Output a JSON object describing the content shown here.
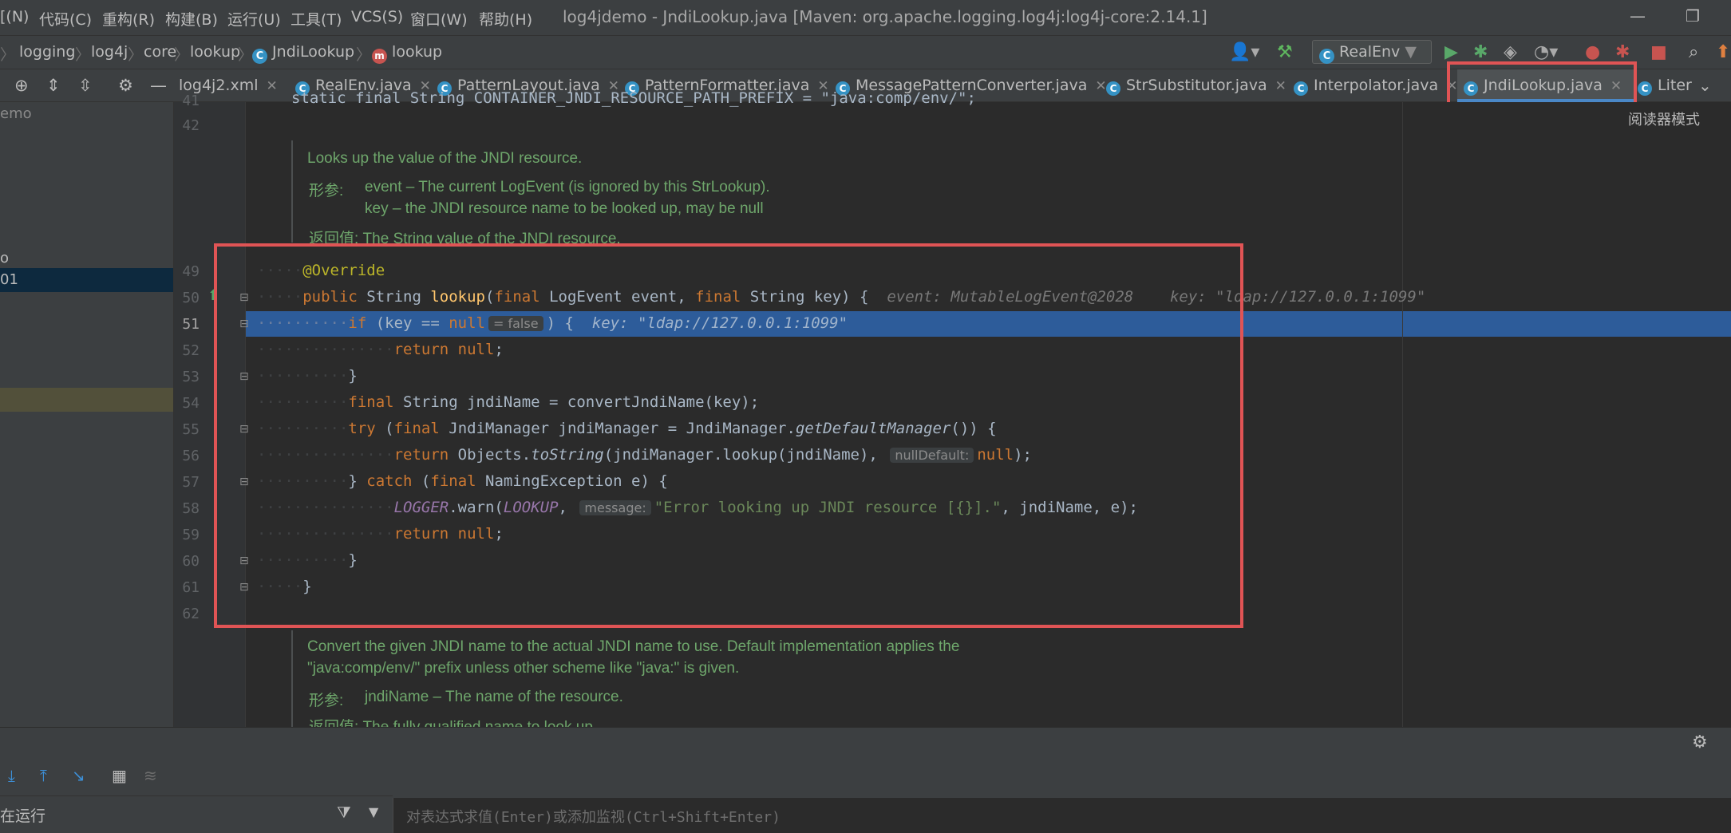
{
  "menu": {
    "items": [
      "[(N)",
      "代码(C)",
      "重构(R)",
      "构建(B)",
      "运行(U)",
      "工具(T)",
      "VCS(S)",
      "窗口(W)",
      "帮助(H)"
    ],
    "title": "log4jdemo - JndiLookup.java [Maven: org.apache.logging.log4j:log4j-core:2.14.1]"
  },
  "breadcrumb": [
    "logging",
    "log4j",
    "core",
    "lookup",
    "JndiLookup",
    "lookup"
  ],
  "run_config": "RealEnv",
  "tabs": [
    {
      "label": "log4j2.xml",
      "icon": "xml-icon"
    },
    {
      "label": "RealEnv.java",
      "icon": "class-icon"
    },
    {
      "label": "PatternLayout.java",
      "icon": "class-icon"
    },
    {
      "label": "PatternFormatter.java",
      "icon": "class-icon"
    },
    {
      "label": "MessagePatternConverter.java",
      "icon": "class-icon"
    },
    {
      "label": "StrSubstitutor.java",
      "icon": "class-icon"
    },
    {
      "label": "Interpolator.java",
      "icon": "class-icon"
    },
    {
      "label": "JndiLookup.java",
      "icon": "class-icon",
      "active": true
    },
    {
      "label": "Liter",
      "icon": "class-icon"
    }
  ],
  "reader_mode": "阅读器模式",
  "left_panel": {
    "item1": "emo",
    "item2": "o",
    "item3": "01"
  },
  "editor": {
    "top_partial_line": "static final String CONTAINER_JNDI_RESOURCE_PATH_PREFIX = \"java:comp/env/\";",
    "line_numbers": [
      "41",
      "42",
      "49",
      "50",
      "51",
      "52",
      "53",
      "54",
      "55",
      "56",
      "57",
      "58",
      "59",
      "60",
      "61",
      "62"
    ],
    "doc1": {
      "summary": "Looks up the value of the JNDI resource.",
      "params_label": "形参:",
      "param1": "event – The current LogEvent (is ignored by this StrLookup).",
      "param2": "key – the JNDI resource name to be looked up, may be null",
      "returns": "返回值: The String value of the JNDI resource."
    },
    "doc2": {
      "line1": "Convert the given JNDI name to the actual JNDI name to use. Default implementation applies the",
      "line2": "\"java:comp/env/\" prefix unless other scheme like \"java:\" is given.",
      "params_label": "形参:",
      "param1": "jndiName – The name of the resource.",
      "returns": "返回值: The fully qualified name to look up."
    },
    "debug_hints": {
      "line50_event": "event: MutableLogEvent@2028",
      "line50_key": "key: \"ldap://127.0.0.1:1099\"",
      "line51_inlay": "= false",
      "line51_key": "key: \"ldap://127.0.0.1:1099\""
    },
    "param_hints": {
      "nullDefault": "nullDefault:",
      "message": "message:"
    }
  },
  "debugger": {
    "running_label": "在运行",
    "eval_placeholder": "对表达式求值(Enter)或添加监视(Ctrl+Shift+Enter)"
  }
}
